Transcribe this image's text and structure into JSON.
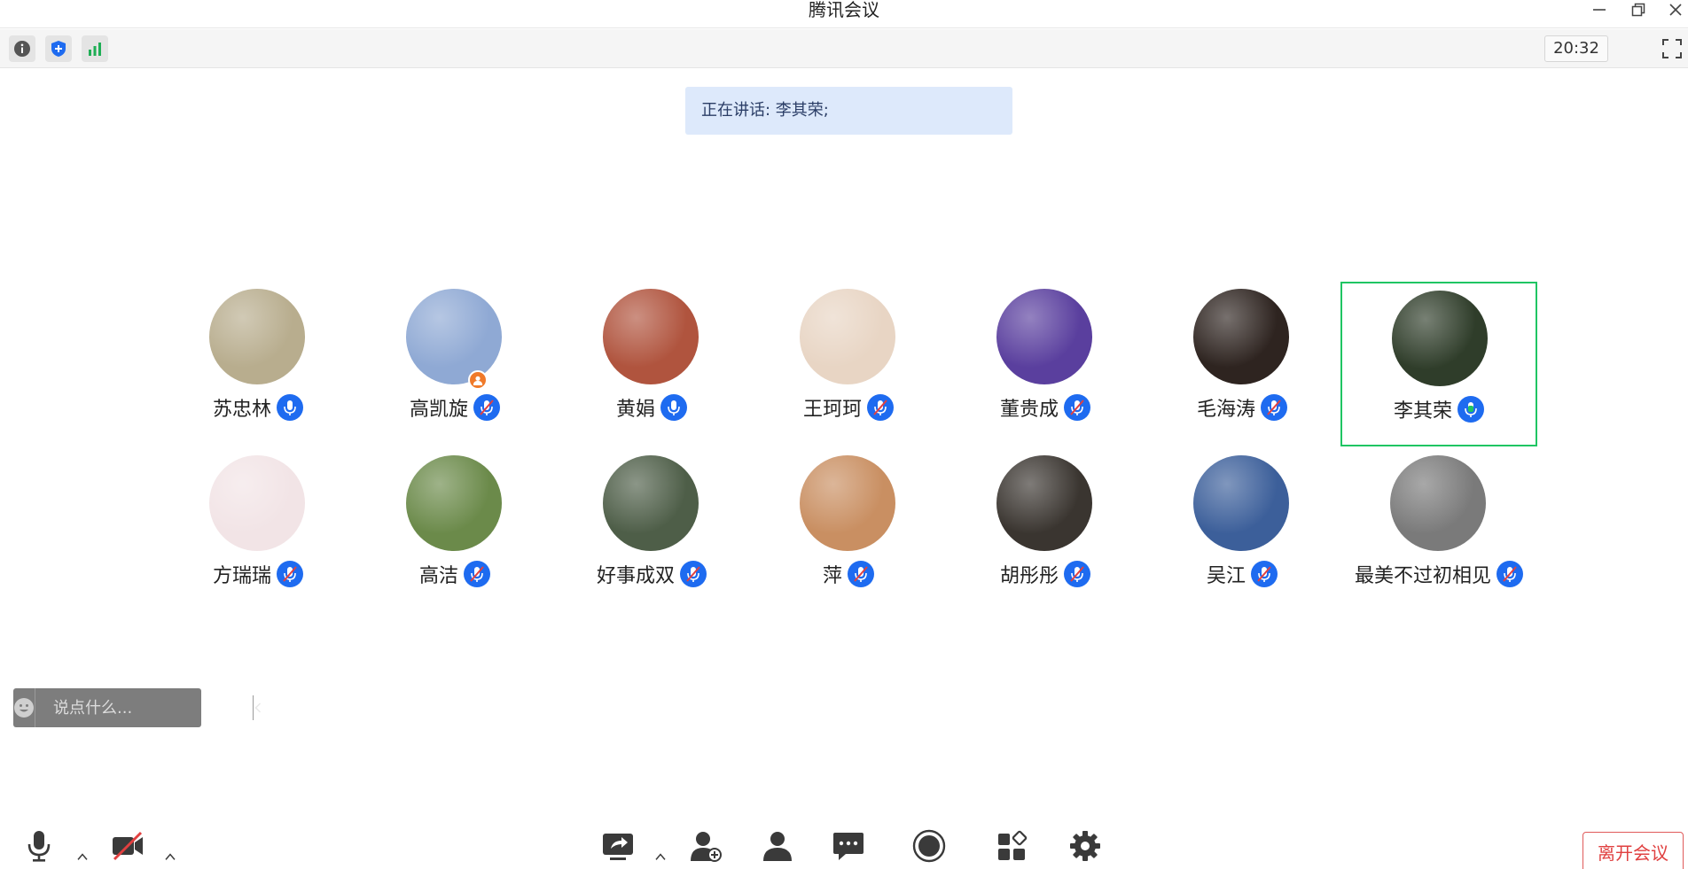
{
  "window": {
    "title": "腾讯会议",
    "controls": [
      "minimize-icon",
      "restore-icon",
      "close-icon"
    ]
  },
  "infobar": {
    "icons": [
      "info-icon",
      "shield-icon",
      "signal-icon"
    ],
    "time": "20:32",
    "fullscreen_icon": "fullscreen-icon"
  },
  "speaking": {
    "label": "正在讲话: 李其荣;"
  },
  "participants": [
    {
      "name": "苏忠林",
      "mic": "on",
      "active": false,
      "bg": "#b8ad8e"
    },
    {
      "name": "高凯旋",
      "mic": "muted",
      "active": false,
      "bg": "#8fa9d4",
      "host": true
    },
    {
      "name": "黄娟",
      "mic": "on",
      "active": false,
      "bg": "#b0543e"
    },
    {
      "name": "王珂珂",
      "mic": "muted",
      "active": false,
      "bg": "#e8d5c4"
    },
    {
      "name": "董贵成",
      "mic": "muted",
      "active": false,
      "bg": "#5a3f9e"
    },
    {
      "name": "毛海涛",
      "mic": "muted",
      "active": false,
      "bg": "#2e2420"
    },
    {
      "name": "李其荣",
      "mic": "speaking",
      "active": true,
      "bg": "#2f3d2a"
    },
    {
      "name": "方瑞瑞",
      "mic": "muted",
      "active": false,
      "bg": "#f2e4e6"
    },
    {
      "name": "高洁",
      "mic": "muted",
      "active": false,
      "bg": "#6b8a4a"
    },
    {
      "name": "好事成双",
      "mic": "muted",
      "active": false,
      "bg": "#4e5e48"
    },
    {
      "name": "萍",
      "mic": "muted",
      "active": false,
      "bg": "#c98f62"
    },
    {
      "name": "胡彤彤",
      "mic": "muted",
      "active": false,
      "bg": "#3a3530"
    },
    {
      "name": "吴江",
      "mic": "muted",
      "active": false,
      "bg": "#3c5f9a"
    },
    {
      "name": "最美不过初相见",
      "mic": "muted",
      "active": false,
      "bg": "#7a7a7a"
    }
  ],
  "chat": {
    "placeholder": "说点什么..."
  },
  "toolbar": {
    "icons": [
      "microphone-icon",
      "camera-off-icon",
      "share-screen-icon",
      "invite-icon",
      "members-icon",
      "chat-icon",
      "record-icon",
      "apps-icon",
      "settings-icon"
    ],
    "leave_label": "离开会议"
  },
  "colors": {
    "accent": "#1e6bf0",
    "active_border": "#1fc563",
    "speaking_bg": "#dde9fb",
    "leave": "#e04040"
  }
}
